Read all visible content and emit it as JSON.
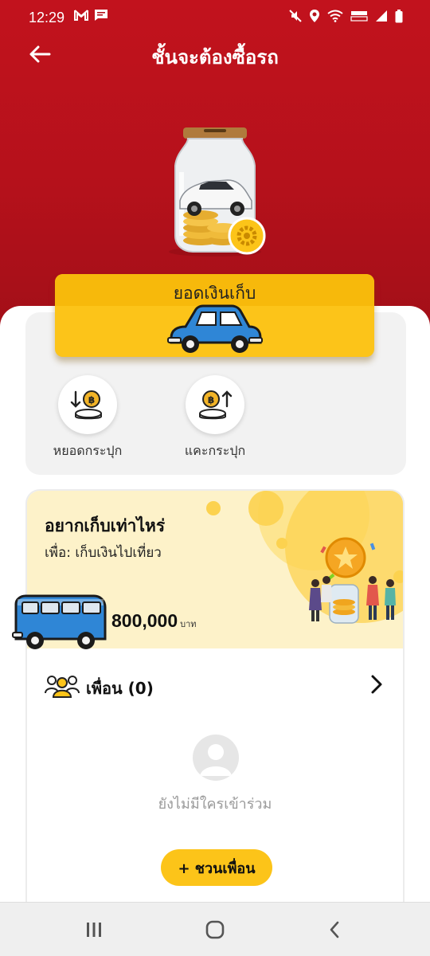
{
  "status_bar": {
    "time": "12:29",
    "left_icons": [
      "gmail-icon",
      "message-icon"
    ],
    "right_icons": [
      "mute-icon",
      "location-icon",
      "wifi-icon",
      "volte-icon",
      "signal-icon",
      "battery-icon"
    ]
  },
  "header": {
    "title": "ชั้นจะต้องซื้อรถ",
    "back_icon": "back-arrow-icon"
  },
  "savings": {
    "label": "ยอดเงินเก็บ"
  },
  "actions": [
    {
      "label": "หยอดกระปุก",
      "icon": "deposit-coin-icon"
    },
    {
      "label": "แคะกระปุก",
      "icon": "withdraw-coin-icon"
    }
  ],
  "goal": {
    "title": "อยากเก็บเท่าไหร่",
    "purpose": "เพื่อ: เก็บเงินไปเที่ยว",
    "amount": "800,000",
    "unit": "บาท"
  },
  "friends": {
    "label": "เพื่อน (0)",
    "empty_text": "ยังไม่มีใครเข้าร่วม",
    "invite_label": "+ ชวนเพื่อน"
  },
  "nav": [
    "recent-apps-icon",
    "home-icon",
    "back-icon"
  ],
  "colors": {
    "header_red": "#b5111b",
    "accent_yellow": "#fcc419",
    "banner_cream": "#fdf2c9"
  }
}
